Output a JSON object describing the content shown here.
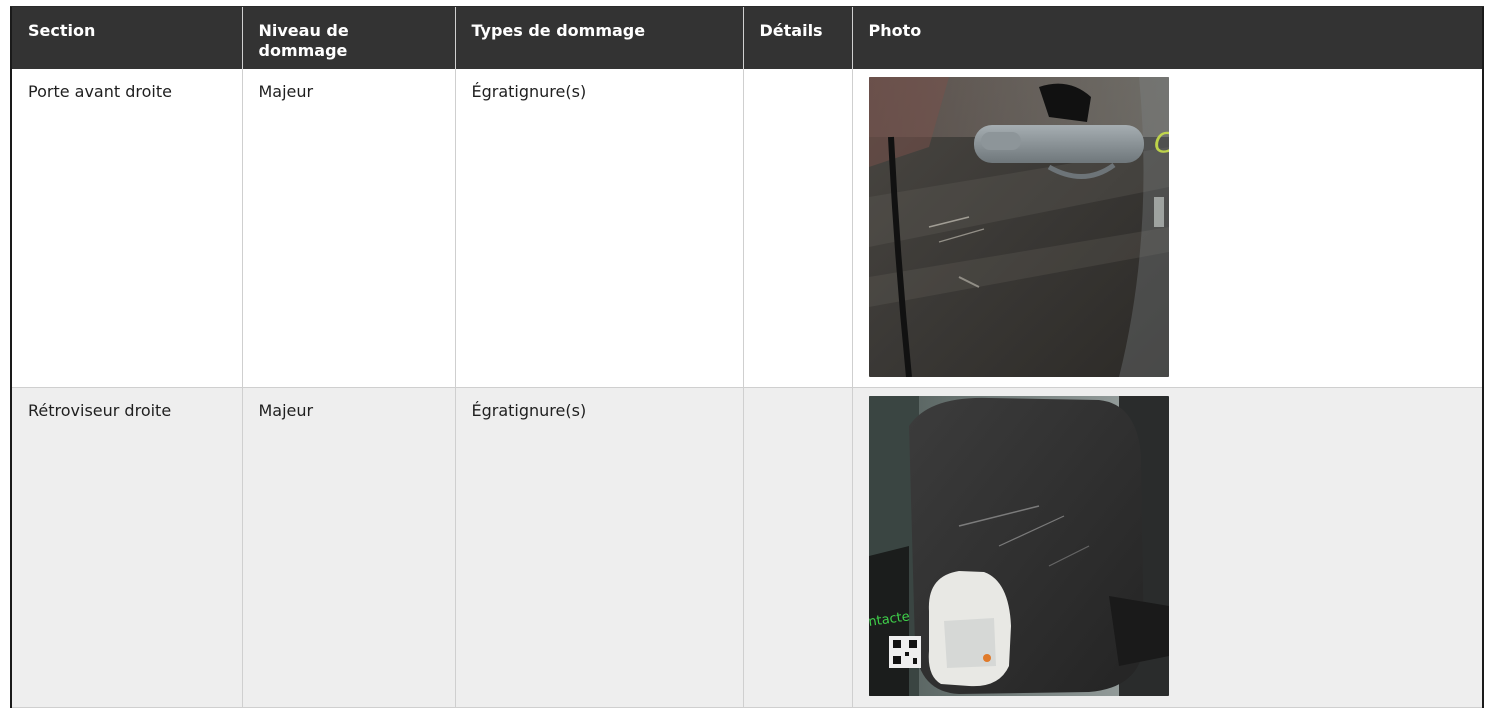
{
  "table": {
    "headers": {
      "section": "Section",
      "level": "Niveau de dommage",
      "types": "Types de dommage",
      "details": "Détails",
      "photo": "Photo"
    },
    "rows": [
      {
        "section": "Porte avant droite",
        "level": "Majeur",
        "types": "Égratignure(s)",
        "details": "",
        "photo": {
          "icon": "car-door-scratch-photo",
          "colors": {
            "body": "#3a3835",
            "handle": "#8e969b",
            "accent": "#c9e04a"
          }
        }
      },
      {
        "section": "Rétroviseur droite",
        "level": "Majeur",
        "types": "Égratignure(s)",
        "details": "",
        "photo": {
          "icon": "side-mirror-scratch-photo",
          "colors": {
            "body": "#2f2f2f",
            "lamp": "#e8e8e4",
            "accent": "#3fd04a"
          }
        }
      }
    ]
  },
  "colors": {
    "header_bg": "#333333",
    "header_text": "#ffffff",
    "row_alt_bg": "#eeeeee",
    "border": "#cfcfcf"
  }
}
